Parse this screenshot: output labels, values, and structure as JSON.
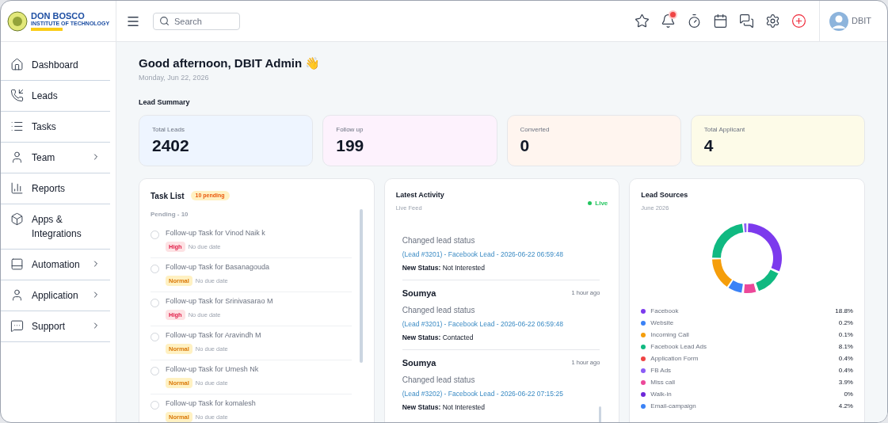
{
  "logo": {
    "title": "DON BOSCO",
    "subtitle": "INSTITUTE OF TECHNOLOGY"
  },
  "header": {
    "search": {
      "placeholder": "Search"
    },
    "icons": [
      {
        "kind": "star",
        "notification": false
      },
      {
        "kind": "bell",
        "notification": true
      },
      {
        "kind": "timer",
        "notification": false
      },
      {
        "kind": "calendar",
        "notification": false
      },
      {
        "kind": "chat",
        "notification": false
      },
      {
        "kind": "settings",
        "notification": false
      },
      {
        "kind": "add",
        "notification": false
      }
    ],
    "user": "DBIT"
  },
  "sidebar": {
    "items": [
      {
        "label": "Dashboard",
        "submenu": false
      },
      {
        "label": "Leads",
        "submenu": false
      },
      {
        "label": "Tasks",
        "submenu": false
      },
      {
        "label": "Team",
        "submenu": true
      },
      {
        "label": "Reports",
        "submenu": false
      },
      {
        "label": "Apps & Integrations",
        "submenu": false
      },
      {
        "label": "Automation",
        "submenu": true
      },
      {
        "label": "Application",
        "submenu": true
      },
      {
        "label": "Support",
        "submenu": true
      }
    ]
  },
  "greeting": {
    "title": "Good afternoon, DBIT Admin 👋",
    "date": "Monday, Jun 22, 2026"
  },
  "summary": {
    "title": "Lead Summary",
    "cards": [
      {
        "label": "Total Leads",
        "value": "2402",
        "color": "#eef5ff"
      },
      {
        "label": "Follow up",
        "value": "199",
        "color": "#fdf2fd"
      },
      {
        "label": "Converted",
        "value": "0",
        "color": "#fff5ef"
      },
      {
        "label": "Total Applicant",
        "value": "4",
        "color": "#fdfbe8"
      }
    ]
  },
  "task_list": {
    "title": "Task List",
    "badge": "10 pending",
    "group": "Pending - 10",
    "tasks": [
      {
        "title": "Follow-up Task for Vinod Naik k",
        "priority": "High",
        "kind": "high",
        "due": "No due date",
        "checked": false
      },
      {
        "title": "Follow-up Task for Basanagouda",
        "priority": "Normal",
        "kind": "normal",
        "due": "No due date",
        "checked": false
      },
      {
        "title": "Follow-up Task for Srinivasarao M",
        "priority": "High",
        "kind": "high",
        "due": "No due date",
        "checked": false
      },
      {
        "title": "Follow-up Task for Aravindh M",
        "priority": "Normal",
        "kind": "normal",
        "due": "No due date",
        "checked": false
      },
      {
        "title": "Follow-up Task for Umesh Nk",
        "priority": "Normal",
        "kind": "normal",
        "due": "No due date",
        "checked": false
      },
      {
        "title": "Follow-up Task for komalesh",
        "priority": "Normal",
        "kind": "normal",
        "due": "No due date",
        "checked": false
      }
    ]
  },
  "activity": {
    "title": "Latest Activity",
    "subtitle": "Live Feed",
    "live": "Live",
    "items": [
      {
        "action": "Changed lead status",
        "link": "(Lead #3201) - Facebook Lead - 2026-06-22 06:59:48",
        "status": "**New Status:** Not Interested"
      },
      {
        "name": "Soumya",
        "time": "1 hour ago",
        "action": "Changed lead status",
        "link": "(Lead #3201) - Facebook Lead - 2026-06-22 06:59:48",
        "status": "**New Status:** Contacted"
      },
      {
        "name": "Soumya",
        "time": "1 hour ago",
        "action": "Changed lead status",
        "link": "(Lead #3202) - Facebook Lead - 2026-06-22 07:15:25",
        "status": "**New Status:** Not Interested"
      }
    ]
  },
  "lead_sources": {
    "title": "Lead Sources",
    "subtitle": "June 2026",
    "legend": [
      {
        "label": "Facebook",
        "value": "18.8%",
        "color": "#7c3aed"
      },
      {
        "label": "Website",
        "value": "0.2%",
        "color": "#3b82f6"
      },
      {
        "label": "Incoming Call",
        "value": "0.1%",
        "color": "#f59e0b"
      },
      {
        "label": "Facebook Lead Ads",
        "value": "8.1%",
        "color": "#10b981"
      },
      {
        "label": "Application Form",
        "value": "0.4%",
        "color": "#ef4444"
      },
      {
        "label": "FB Ads",
        "value": "0.4%",
        "color": "#8b5cf6"
      },
      {
        "label": "Miss call",
        "value": "3.9%",
        "color": "#ec4899"
      },
      {
        "label": "Walk-in",
        "value": "0%",
        "color": "#6d28d9"
      },
      {
        "label": "Email-campaign",
        "value": "4.2%",
        "color": "#3b82f6"
      }
    ]
  }
}
